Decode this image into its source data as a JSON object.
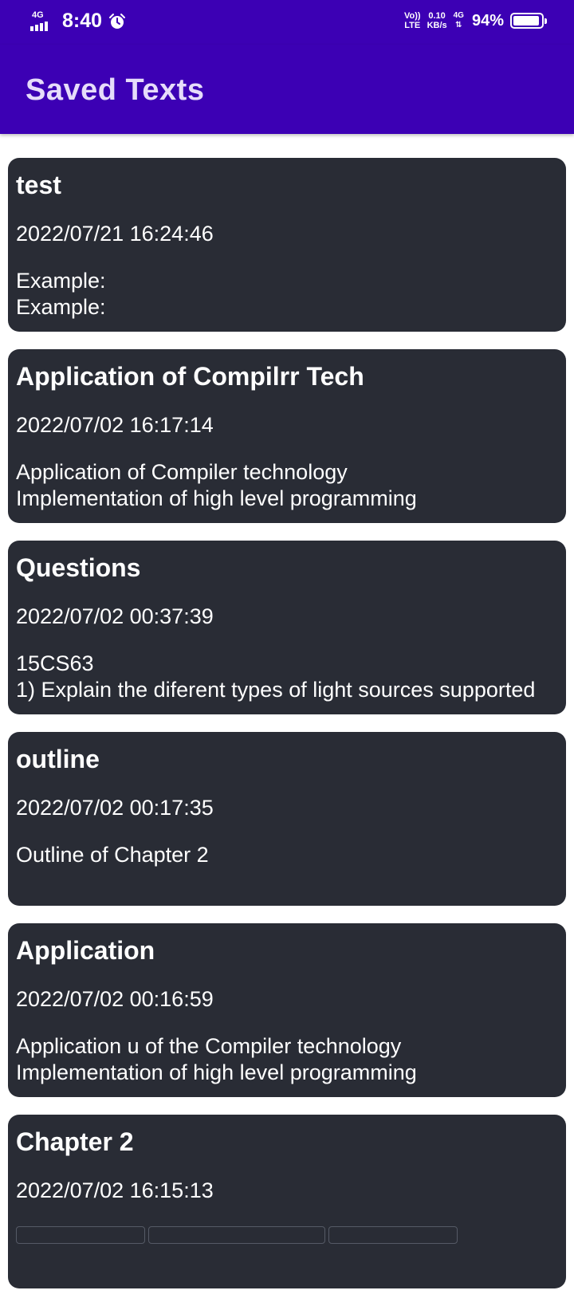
{
  "status_bar": {
    "network_type": "4G",
    "time": "8:40",
    "volte_top": "Vo))",
    "volte_bottom": "LTE",
    "speed_value": "0.10",
    "speed_unit": "KB/s",
    "network_right": "4G",
    "battery_percent": "94%",
    "battery_level": 0.94
  },
  "app_bar": {
    "title": "Saved Texts"
  },
  "notes": [
    {
      "title": "test",
      "date": "2022/07/21 16:24:46",
      "body": "Example:\nExample:"
    },
    {
      "title": "Application of Compilrr Tech",
      "date": "2022/07/02 16:17:14",
      "body": "Application of Compiler technology\nImplementation of high level programming"
    },
    {
      "title": "Questions",
      "date": "2022/07/02 00:37:39",
      "body": "15CS63\n1) Explain the diferent types of light sources supported"
    },
    {
      "title": "outline",
      "date": "2022/07/02 00:17:35",
      "body": "Outline of Chapter 2"
    },
    {
      "title": "Application",
      "date": "2022/07/02 00:16:59",
      "body": "Application u of the Compiler technology\nImplementation of high level programming"
    },
    {
      "title": "Chapter 2",
      "date": "2022/07/02 16:15:13",
      "body": ""
    }
  ],
  "colors": {
    "primary": "#3c00b4",
    "title_text": "#e6dcfa",
    "card_bg": "#292c35",
    "card_text": "#ffffff"
  }
}
